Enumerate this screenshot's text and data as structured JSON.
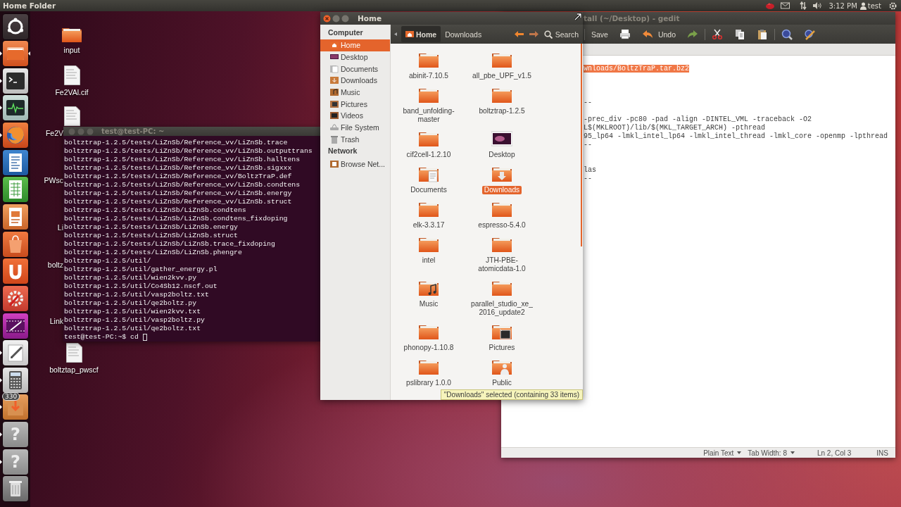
{
  "top_panel": {
    "app_title": "Home Folder",
    "clock": "3:12 PM",
    "user": "test"
  },
  "launcher": [
    {
      "kind": "dash",
      "running": false,
      "focused": false
    },
    {
      "kind": "files",
      "running": true,
      "focused": true
    },
    {
      "kind": "terminal",
      "running": true,
      "focused": false
    },
    {
      "kind": "monitor",
      "running": true,
      "focused": false
    },
    {
      "kind": "browser",
      "running": true,
      "focused": false
    },
    {
      "kind": "writer",
      "running": false,
      "focused": false
    },
    {
      "kind": "calc",
      "running": false,
      "focused": false
    },
    {
      "kind": "impress",
      "running": false,
      "focused": false
    },
    {
      "kind": "store",
      "running": false,
      "focused": false
    },
    {
      "kind": "one",
      "running": false,
      "focused": false
    },
    {
      "kind": "settings",
      "running": false,
      "focused": false
    },
    {
      "kind": "video",
      "running": false,
      "focused": false
    },
    {
      "kind": "editor",
      "running": true,
      "focused": false
    },
    {
      "kind": "calculator",
      "running": true,
      "focused": false
    },
    {
      "kind": "updates",
      "running": true,
      "focused": false,
      "badge": "330"
    },
    {
      "kind": "unknown",
      "running": true,
      "focused": false,
      "glyph": "?"
    },
    {
      "kind": "unknown",
      "running": true,
      "focused": false,
      "glyph": "?"
    },
    {
      "kind": "trash",
      "running": false,
      "focused": false
    }
  ],
  "desktop_icons": [
    {
      "label": "input",
      "kind": "folder"
    },
    {
      "label": "Fe2VAl.cif",
      "kind": "file"
    },
    {
      "label": "Fe2V",
      "kind": "file"
    },
    {
      "label": "PWsc",
      "kind": "hidden"
    },
    {
      "label": "Li",
      "kind": "hidden"
    },
    {
      "label": "boltz",
      "kind": "hidden"
    },
    {
      "label": "Link",
      "kind": "hidden"
    },
    {
      "label": "boltztap_pwscf",
      "kind": "file"
    }
  ],
  "terminal": {
    "title": "test@test-PC: ~",
    "lines": [
      "boltztrap-1.2.5/tests/LiZnSb/Reference_vv/LiZnSb.trace",
      "boltztrap-1.2.5/tests/LiZnSb/Reference_vv/LiZnSb.outputtrans",
      "boltztrap-1.2.5/tests/LiZnSb/Reference_vv/LiZnSb.halltens",
      "boltztrap-1.2.5/tests/LiZnSb/Reference_vv/LiZnSb.sigxxx",
      "boltztrap-1.2.5/tests/LiZnSb/Reference_vv/BoltzTraP.def",
      "boltztrap-1.2.5/tests/LiZnSb/Reference_vv/LiZnSb.condtens",
      "boltztrap-1.2.5/tests/LiZnSb/Reference_vv/LiZnSb.energy",
      "boltztrap-1.2.5/tests/LiZnSb/Reference_vv/LiZnSb.struct",
      "boltztrap-1.2.5/tests/LiZnSb/LiZnSb.condtens",
      "boltztrap-1.2.5/tests/LiZnSb/LiZnSb.condtens_fixdoping",
      "boltztrap-1.2.5/tests/LiZnSb/LiZnSb.energy",
      "boltztrap-1.2.5/tests/LiZnSb/LiZnSb.struct",
      "boltztrap-1.2.5/tests/LiZnSb/LiZnSb.trace_fixdoping",
      "boltztrap-1.2.5/tests/LiZnSb/LiZnSb.phengre",
      "boltztrap-1.2.5/util/",
      "boltztrap-1.2.5/util/gather_energy.pl",
      "boltztrap-1.2.5/util/wien2kvv.py",
      "boltztrap-1.2.5/util/Co4Sb12.nscf.out",
      "boltztrap-1.2.5/util/vasp2boltz.txt",
      "boltztrap-1.2.5/util/qe2boltz.py",
      "boltztrap-1.2.5/util/wien2kvv.txt",
      "boltztrap-1.2.5/util/vasp2boltz.py",
      "boltztrap-1.2.5/util/qe2boltz.txt"
    ],
    "prompt": "test@test-PC:~$ cd"
  },
  "file_manager": {
    "title": "Home",
    "sidebar": [
      {
        "heading": "Computer",
        "items": [
          {
            "label": "Home",
            "kind": "home",
            "selected": true
          },
          {
            "label": "Desktop",
            "kind": "desktop",
            "selected": false
          },
          {
            "label": "Documents",
            "kind": "documents",
            "selected": false
          },
          {
            "label": "Downloads",
            "kind": "downloads",
            "selected": false
          },
          {
            "label": "Music",
            "kind": "music",
            "selected": false
          },
          {
            "label": "Pictures",
            "kind": "pictures",
            "selected": false
          },
          {
            "label": "Videos",
            "kind": "videos",
            "selected": false
          },
          {
            "label": "File System",
            "kind": "drive",
            "selected": false
          },
          {
            "label": "Trash",
            "kind": "trash",
            "selected": false
          }
        ]
      },
      {
        "heading": "Network",
        "items": [
          {
            "label": "Browse Net...",
            "kind": "network",
            "selected": false
          }
        ]
      }
    ],
    "path": [
      {
        "label": "Home",
        "selected": true
      },
      {
        "label": "Downloads",
        "selected": false
      }
    ],
    "search": "Search",
    "items": [
      {
        "label": "abinit-7.10.5",
        "kind": "folder",
        "selected": false
      },
      {
        "label": "all_pbe_UPF_v1.5",
        "kind": "folder",
        "selected": false
      },
      {
        "label": "band_unfolding-\nmaster",
        "kind": "folder",
        "selected": false
      },
      {
        "label": "boltztrap-1.2.5",
        "kind": "folder",
        "selected": false
      },
      {
        "label": "cif2cell-1.2.10",
        "kind": "folder",
        "selected": false
      },
      {
        "label": "Desktop",
        "kind": "desktop",
        "selected": false
      },
      {
        "label": "Documents",
        "kind": "documents",
        "selected": false
      },
      {
        "label": "Downloads",
        "kind": "downloads",
        "selected": true
      },
      {
        "label": "elk-3.3.17",
        "kind": "folder",
        "selected": false
      },
      {
        "label": "espresso-5.4.0",
        "kind": "folder",
        "selected": false
      },
      {
        "label": "intel",
        "kind": "folder",
        "selected": false
      },
      {
        "label": "JTH-PBE-\natomicdata-1.0",
        "kind": "folder",
        "selected": false
      },
      {
        "label": "Music",
        "kind": "music",
        "selected": false
      },
      {
        "label": "parallel_studio_xe_\n2016_update2",
        "kind": "folder",
        "selected": false
      },
      {
        "label": "phonopy-1.10.8",
        "kind": "folder",
        "selected": false
      },
      {
        "label": "Pictures",
        "kind": "pictures",
        "selected": false
      },
      {
        "label": "pslibrary 1.0.0",
        "kind": "folder",
        "selected": false
      },
      {
        "label": "Public",
        "kind": "public",
        "selected": false
      }
    ],
    "status": "\"Downloads\" selected (containing 33 items)"
  },
  "editor": {
    "title": "tall (~/Desktop) - gedit",
    "toolbar": [
      {
        "kind": "save",
        "label": "Save"
      },
      {
        "kind": "print"
      },
      {
        "kind": "undo",
        "label": "Undo"
      },
      {
        "kind": "redo"
      },
      {
        "kind": "cut"
      },
      {
        "kind": "copy"
      },
      {
        "kind": "paste"
      },
      {
        "kind": "find"
      },
      {
        "kind": "replace"
      }
    ],
    "selection": "wnloads/BoltzTraP.tar.bz2",
    "text": "\n\n\n\n--\n\n-prec_div -pc80 -pad -align -DINTEL_VML -traceback -O2\nL$(MKLROOT)/lib/$(MKL_TARGET_ARCH) -pthread\n95_lp64 -lmkl_intel_lp64 -lmkl_intel_thread -lmkl_core -openmp -lpthread\n--\n\n\nlas\n--",
    "status": {
      "language": "Plain Text",
      "tab_width": "Tab Width: 8",
      "position": "Ln 2, Col 3",
      "mode": "INS"
    }
  }
}
